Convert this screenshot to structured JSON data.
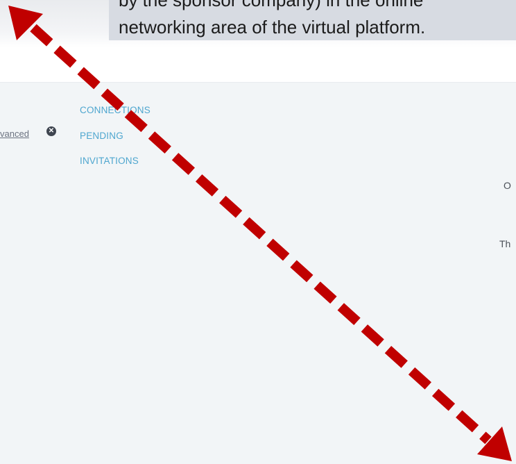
{
  "caption": {
    "line1": "by the sponsor company) in the online",
    "line2": "networking area of the virtual platform."
  },
  "filters": {
    "advanced_label": "vanced",
    "clear_icon": "close-circle-icon"
  },
  "tabs": [
    {
      "label": "CONNECTIONS"
    },
    {
      "label": "PENDING"
    },
    {
      "label": "INVITATIONS"
    }
  ],
  "right_panel": {
    "text_1": "O",
    "text_2": "Th"
  },
  "annotation": {
    "type": "double-headed dashed arrow",
    "color": "#c00000"
  }
}
